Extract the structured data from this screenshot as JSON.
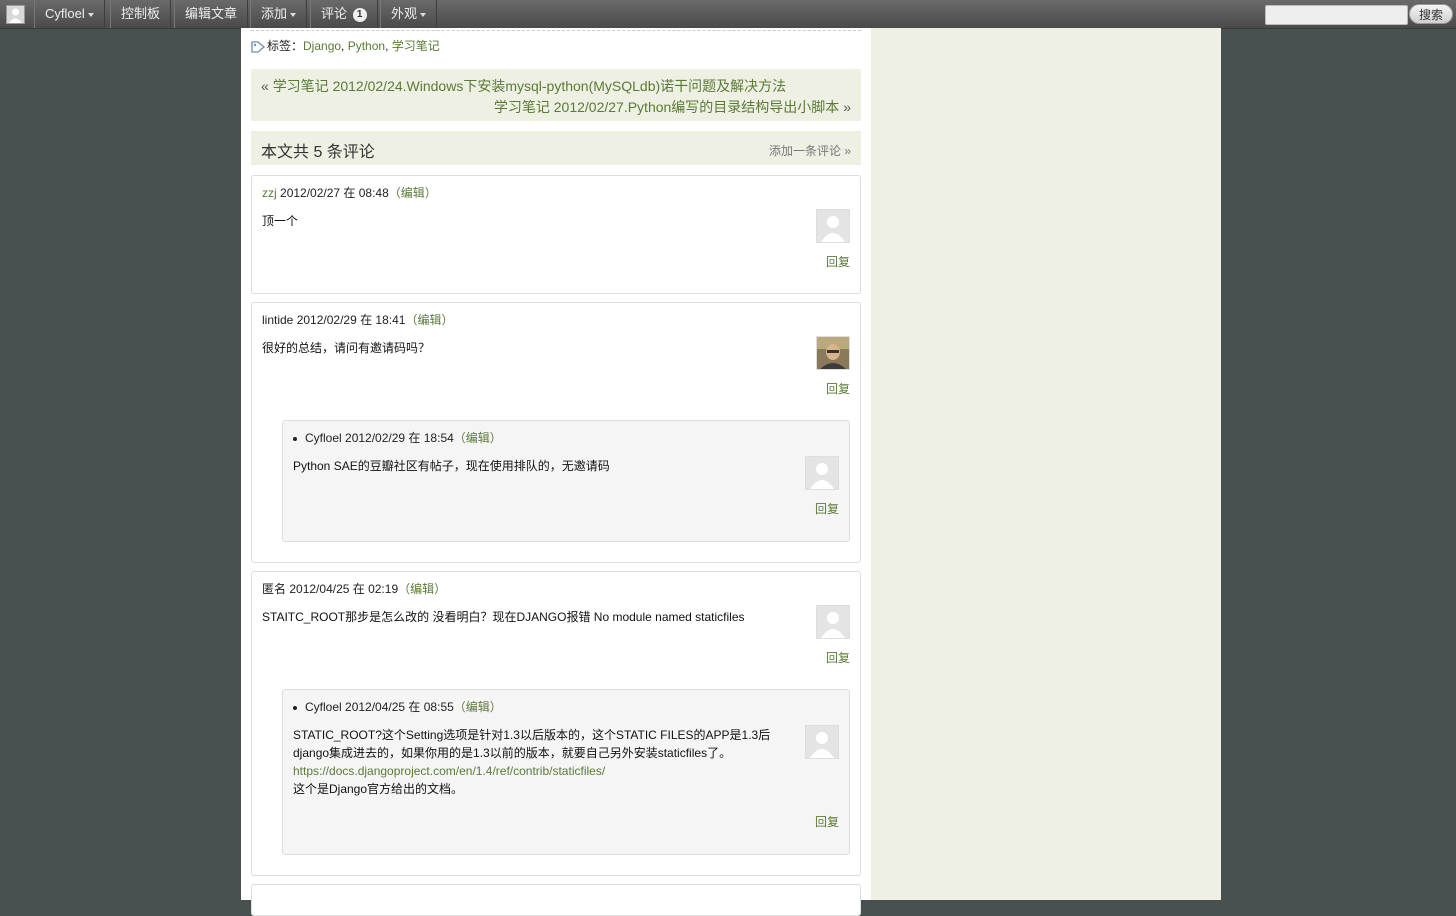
{
  "adminbar": {
    "site": "Cyfloel",
    "dashboard": "控制板",
    "edit_post": "编辑文章",
    "add": "添加",
    "comments": "评论",
    "comments_count": "1",
    "appearance": "外观",
    "search_button": "搜索",
    "search_placeholder": ""
  },
  "tags": {
    "label": "标签：",
    "items": [
      "Django",
      "Python",
      "学习笔记"
    ],
    "separator": ", "
  },
  "post_nav": {
    "prev_arrow": "«",
    "prev_title": "学习笔记 2012/02/24.Windows下安装mysql-python(MySQLdb)诺干问题及解决方法",
    "next_title": "学习笔记 2012/02/27.Python编写的目录结构导出小脚本",
    "next_arrow": "»"
  },
  "comments_header": {
    "title": "本文共 5 条评论",
    "add_link": "添加一条评论 »"
  },
  "comments": [
    {
      "author": "zzj",
      "date": "2012/02/27 在 08:48",
      "edit": "（编辑）",
      "text": "顶一个",
      "reply": "回复"
    },
    {
      "author": "lintide",
      "date": "2012/02/29 在 18:41",
      "edit": "（编辑）",
      "text": "很好的总结，请问有邀请码吗？",
      "reply": "回复",
      "child": {
        "author": "Cyfloel",
        "date": "2012/02/29 在 18:54",
        "edit": "（编辑）",
        "text": "Python SAE的豆瓣社区有帖子，现在使用排队的，无邀请码",
        "reply": "回复"
      }
    },
    {
      "author": "匿名",
      "date": "2012/04/25 在 02:19",
      "edit": "（编辑）",
      "text": "STAITC_ROOT那步是怎么改的 没看明白？现在DJANGO报错 No module named staticfiles",
      "reply": "回复",
      "child": {
        "author": "Cyfloel",
        "date": "2012/04/25 在 08:55",
        "edit": "（编辑）",
        "text_line1": "STATIC_ROOT?这个Setting选项是针对1.3以后版本的，这个STATIC FILES的APP是1.3后",
        "text_line2": "django集成进去的，如果你用的是1.3以前的版本，就要自己另外安装staticfiles了。",
        "link": "https://docs.djangoproject.com/en/1.4/ref/contrib/staticfiles/",
        "text_line4": "这个是Django官方给出的文档。",
        "reply": "回复"
      }
    }
  ],
  "colors": {
    "background": "#495050",
    "sidebar": "#eef0e3",
    "link": "#5b7a36"
  }
}
